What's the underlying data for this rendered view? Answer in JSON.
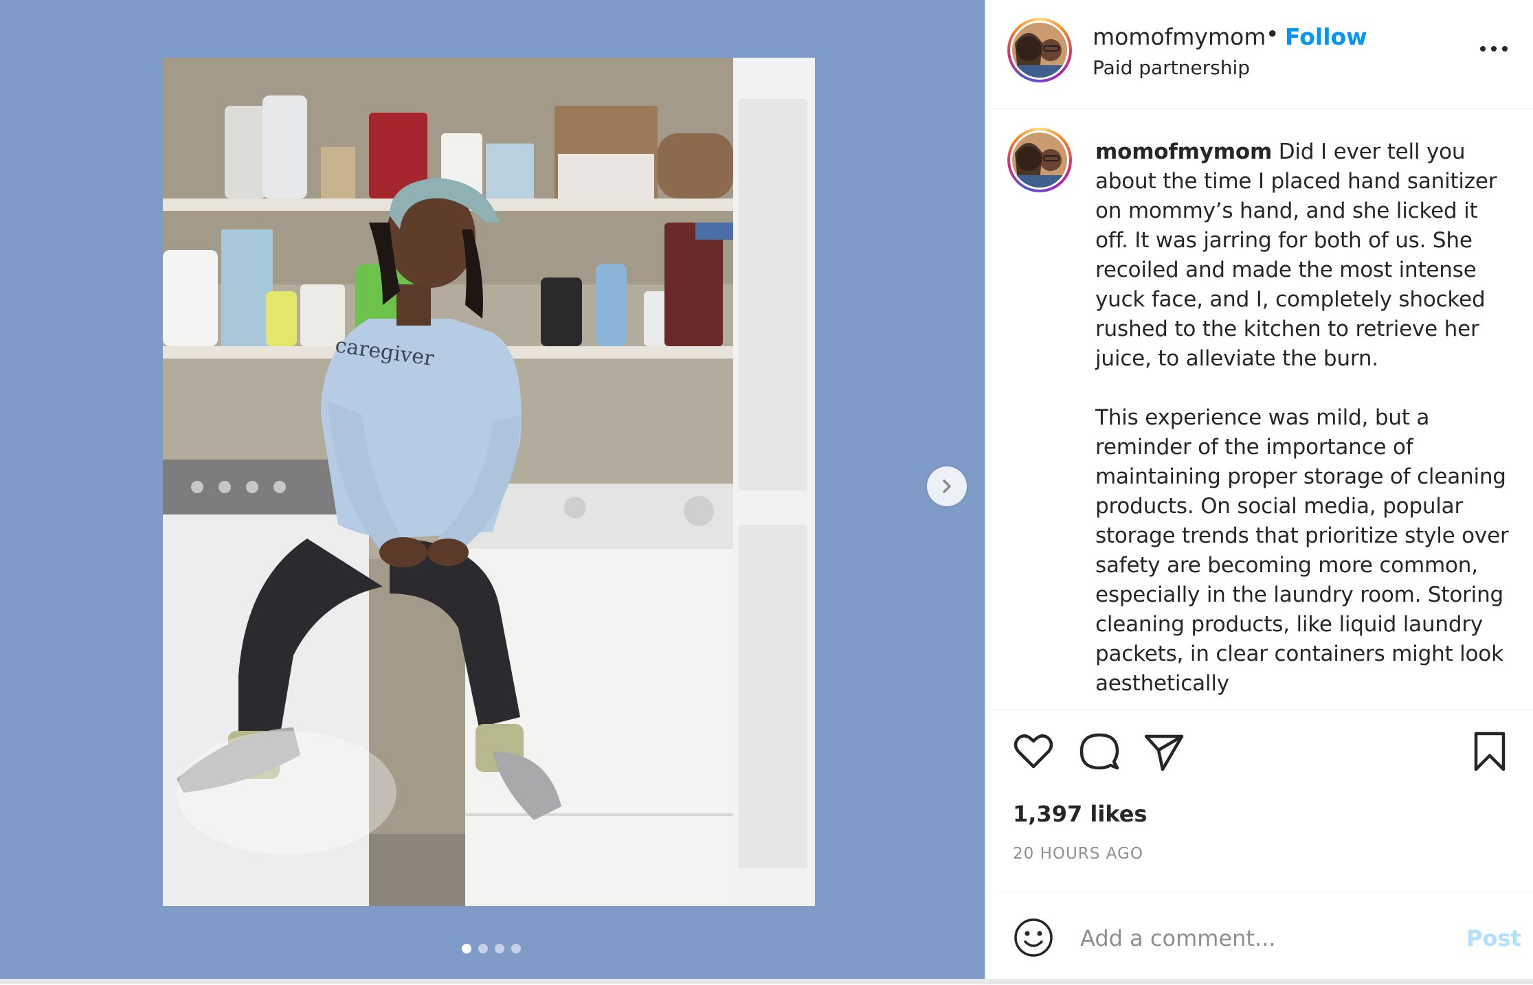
{
  "post": {
    "username": "momofmymom",
    "separator": "•",
    "follow_label": "Follow",
    "subtitle": "Paid partnership",
    "caption_p1": "Did I ever tell you about the time I placed hand sanitizer on mommy’s hand, and she licked it off. It was jarring for both of us. She recoiled and made the most intense yuck face, and I, completely shocked rushed to the kitchen to retrieve her juice, to alleviate the burn.",
    "caption_p2": "This experience was mild, but a reminder of the importance of maintaining proper storage of cleaning products. On social media, popular storage trends that prioritize style over safety are becoming more common, especially in the laundry room. Storing cleaning products, like liquid laundry packets, in clear containers might look aesthetically",
    "likes": "1,397 likes",
    "time": "20 HOURS AGO"
  },
  "photo": {
    "sweatshirt_text": "caregiver"
  },
  "carousel": {
    "count": 4,
    "active_index": 0
  },
  "comment": {
    "placeholder": "Add a comment...",
    "post_label": "Post"
  },
  "colors": {
    "media_bg": "#7f9bc8",
    "follow": "#0095f6",
    "post_disabled": "#b2dffc",
    "muted": "#8e8e8e"
  },
  "icons": [
    "heart-icon",
    "comment-icon",
    "share-icon",
    "bookmark-icon",
    "more-icon",
    "chevron-right-icon",
    "emoji-icon"
  ]
}
